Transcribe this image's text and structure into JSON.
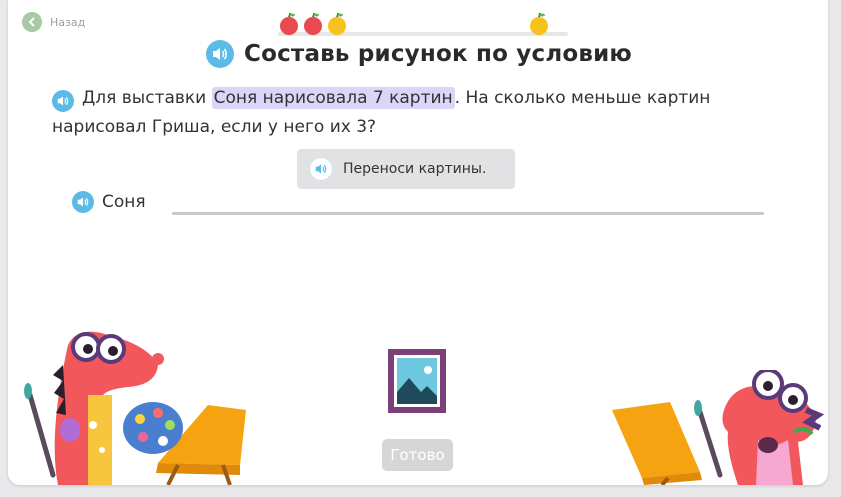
{
  "nav": {
    "back_label": "Назад"
  },
  "title": "Составь рисунок по условию",
  "task": {
    "text_before": "Для выставки ",
    "highlight": "Соня нарисовала 7 картин",
    "text_after": ". На сколько меньше картин нарисовал Гриша, если у него их 3?"
  },
  "hint": {
    "label": "Переноси картины."
  },
  "row": {
    "label": "Соня"
  },
  "done_button": {
    "label": "Готово"
  },
  "colors": {
    "accent_speaker": "#5bbbe6",
    "highlight": "#dcd5f7",
    "picture_frame": "#7b3f79",
    "done_disabled": "#d6d6d6"
  },
  "icons": [
    "arrow-left-icon",
    "speaker-icon",
    "apple-icon",
    "lemon-icon",
    "picture-icon"
  ]
}
